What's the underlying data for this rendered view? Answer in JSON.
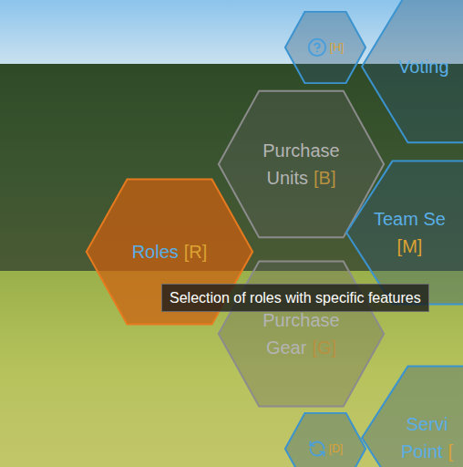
{
  "menu": {
    "hexes": [
      {
        "kind": "help",
        "lines": [
          {
            "text": "",
            "key": "[H]"
          }
        ],
        "selected": false,
        "disabled": false
      },
      {
        "kind": "large",
        "lines": [
          {
            "text": "Voting",
            "key": ""
          }
        ],
        "selected": false,
        "disabled": false
      },
      {
        "kind": "large",
        "lines": [
          {
            "text": "Purchase",
            "key": ""
          },
          {
            "text": "Units",
            "key": "[B]"
          }
        ],
        "selected": false,
        "disabled": true
      },
      {
        "kind": "large",
        "lines": [
          {
            "text": "Team Se",
            "key": ""
          },
          {
            "text": "",
            "key": "[M]"
          }
        ],
        "selected": false,
        "disabled": false
      },
      {
        "kind": "large",
        "lines": [
          {
            "text": "Purchase",
            "key": ""
          },
          {
            "text": "Gear",
            "key": "[G]"
          }
        ],
        "selected": false,
        "disabled": true
      },
      {
        "kind": "large",
        "lines": [
          {
            "text": "Servi",
            "key": ""
          },
          {
            "text": "Point",
            "key": "["
          }
        ],
        "selected": false,
        "disabled": false
      },
      {
        "kind": "cycle",
        "lines": [
          {
            "text": "",
            "key": "[D]"
          }
        ],
        "selected": false,
        "disabled": false
      },
      {
        "kind": "large",
        "lines": [
          {
            "text": "Roles",
            "key": "[R]"
          }
        ],
        "selected": true,
        "disabled": false
      }
    ]
  },
  "tooltip": {
    "text": "Selection of roles with specific features"
  }
}
